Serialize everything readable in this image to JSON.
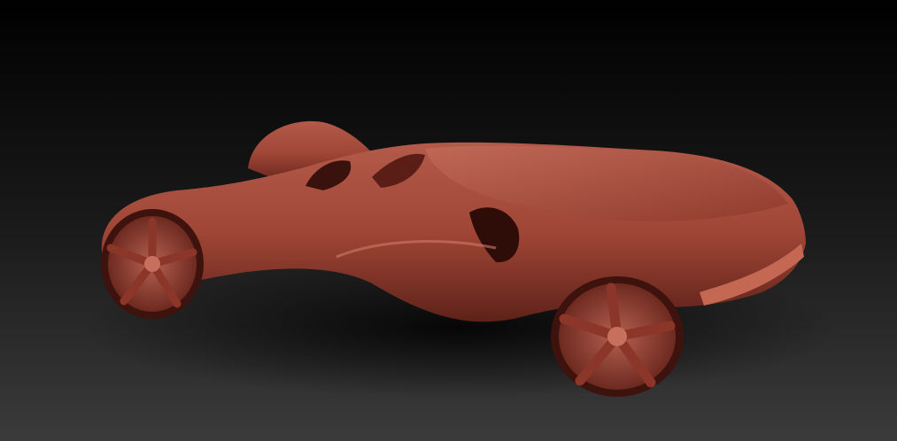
{
  "scene": {
    "subject": "concept-car-clay-render",
    "colors": {
      "background_top": "#000000",
      "background_bottom": "#3a3a3a",
      "clay": "#a64a3c",
      "clay_highlight": "#c8705e",
      "clay_shadow": "#4a1a14"
    }
  }
}
